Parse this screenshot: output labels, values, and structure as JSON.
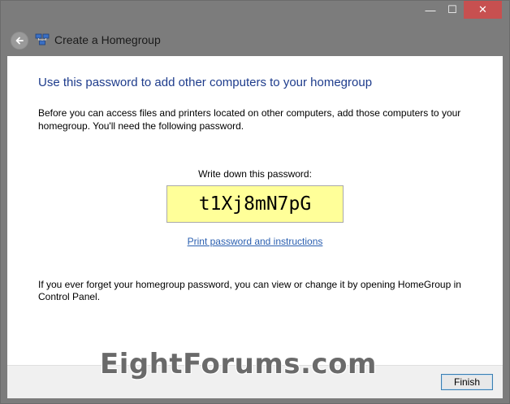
{
  "window": {
    "title": "Create a Homegroup",
    "minimize_glyph": "—",
    "maximize_glyph": "☐",
    "close_glyph": "✕"
  },
  "main": {
    "heading": "Use this password to add other computers to your homegroup",
    "description": "Before you can access files and printers located on other computers, add those computers to your homegroup. You'll need the following password.",
    "password_label": "Write down this password:",
    "password": "t1Xj8mN7pG",
    "print_link": "Print password and instructions",
    "forget_text": "If you ever forget your homegroup password, you can view or change it by opening HomeGroup in Control Panel."
  },
  "footer": {
    "watermark": "EightForums.com",
    "finish_label": "Finish"
  },
  "colors": {
    "heading": "#1e3c8c",
    "link": "#2a5fb0",
    "password_bg": "#ffff99",
    "titlebar": "#7c7c7c",
    "close_button": "#c75050"
  },
  "icons": {
    "back": "back-arrow-icon",
    "homegroup": "homegroup-icon"
  }
}
